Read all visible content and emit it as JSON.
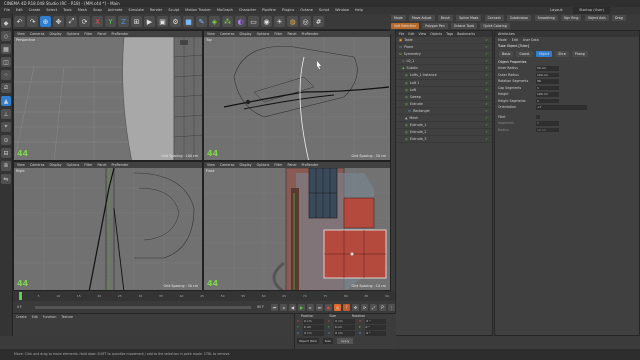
{
  "window": {
    "title": "CINEMA 4D R18.048 Studio (RC - R18) - [MM.c4d *] - Main"
  },
  "menu": [
    "File",
    "Edit",
    "Create",
    "Select",
    "Tools",
    "Mesh",
    "Snap",
    "Animate",
    "Simulate",
    "Render",
    "Sculpt",
    "Motion Tracker",
    "MoGraph",
    "Character",
    "Pipeline",
    "Plugins",
    "Octane",
    "Script",
    "Window",
    "Help"
  ],
  "layout": {
    "label": "Layout:",
    "value": "Startup (User)"
  },
  "viewport_menu": [
    "View",
    "Cameras",
    "Display",
    "Options",
    "Filter",
    "Panel",
    "ProRender"
  ],
  "viewports": [
    {
      "label": "Perspective",
      "grid": "Grid Spacing : 100 cm"
    },
    {
      "label": "Top",
      "grid": "Grid Spacing : 50 cm"
    },
    {
      "label": "Right",
      "grid": "Grid Spacing : 50 cm"
    },
    {
      "label": "Front",
      "grid": "Grid Spacing : 10 cm"
    }
  ],
  "axis_label": "44",
  "right_tabs": [
    "Mode",
    "Move Adjust",
    "Brush",
    "Spline Mask",
    "Connect",
    "Subdivision",
    "Smoothing",
    "Kgn Ring",
    "Object Axis",
    "Drag",
    "Soft Selection",
    "Polygon Pen",
    "Octane Tools",
    "Quick Coloring"
  ],
  "object_manager": {
    "menu": [
      "File",
      "Edit",
      "View",
      "Objects",
      "Tags",
      "Bookmarks"
    ],
    "items": [
      "Table",
      "Plane",
      "Symmetry",
      "L0_1",
      "Subdiv",
      "Lofts_1 Instance",
      "Loft 1",
      "Loft",
      "Sweep",
      "Extrude",
      "Rectangle",
      "Mesh",
      "Extrude_1",
      "Extrude_2",
      "Extrude_3"
    ]
  },
  "attributes": {
    "title": "Attributes",
    "menu": [
      "Mode",
      "Edit",
      "User Data"
    ],
    "object_title": "Tube Object [Tube]",
    "tabs": [
      "Basic",
      "Coord.",
      "Object",
      "Slice",
      "Phong"
    ],
    "section": "Object Properties",
    "fields": [
      {
        "label": "Inner Radius",
        "value": "50 cm"
      },
      {
        "label": "Outer Radius",
        "value": "100 cm"
      },
      {
        "label": "Rotation Segments",
        "value": "36"
      },
      {
        "label": "Cap Segments",
        "value": "1"
      },
      {
        "label": "Height",
        "value": "100 cm"
      },
      {
        "label": "Height Segments",
        "value": "1"
      },
      {
        "label": "Orientation",
        "value": "+Y"
      },
      {
        "label": "Fillet",
        "value": ""
      },
      {
        "label": "Segments",
        "value": "5"
      },
      {
        "label": "Radius",
        "value": "10 cm"
      }
    ]
  },
  "timeline": {
    "ticks": [
      "0",
      "5",
      "10",
      "15",
      "20",
      "25",
      "30",
      "35",
      "40",
      "45",
      "50",
      "55",
      "60",
      "65",
      "70",
      "75",
      "80",
      "85",
      "90"
    ],
    "frame_start": "0 F",
    "frame_end": "90 F",
    "current": "0 F",
    "end_field": "90 F"
  },
  "materials_menu": [
    "Create",
    "Edit",
    "Function",
    "Texture"
  ],
  "coordinates": {
    "headers": [
      "Position",
      "Size",
      "Rotation"
    ],
    "rows": [
      {
        "p": "0 cm",
        "s": "0 cm",
        "r": "0 °"
      },
      {
        "p": "0 cm",
        "s": "0 cm",
        "r": "0 °"
      },
      {
        "p": "0 cm",
        "s": "0 cm",
        "r": "0 °"
      }
    ],
    "mode": "Object (Rel)",
    "size_mode": "Size",
    "apply": "Apply"
  },
  "status": "Move: Click and drag to move elements. Hold down SHIFT to quantize movement / add to the selection in point mode. CTRL to remove.",
  "colors": {
    "accent": "#2f7ecf",
    "green": "#7fd34a"
  }
}
